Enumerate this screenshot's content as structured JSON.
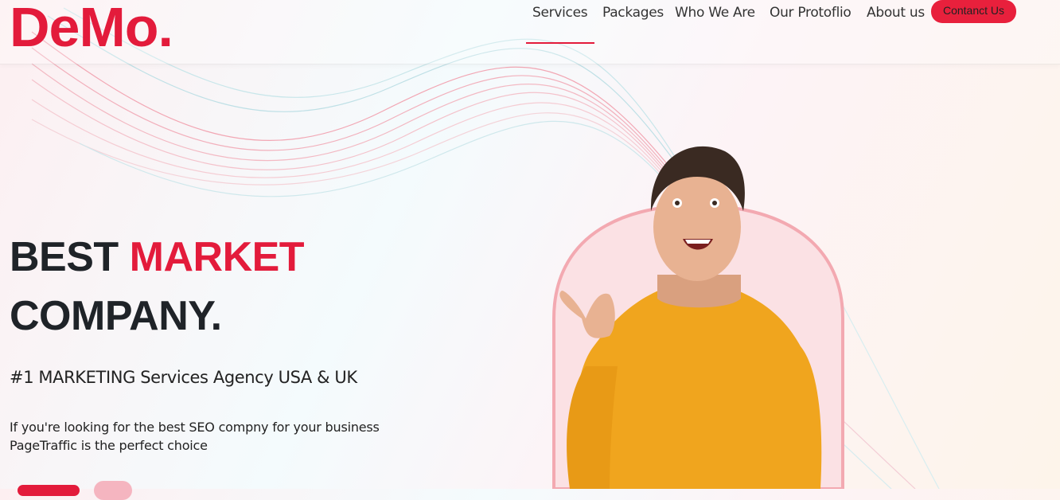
{
  "brand": {
    "logo_text": "DeMo."
  },
  "nav": {
    "items": [
      "Services",
      "Packages",
      "Who We Are",
      "Our Protoflio",
      "About us"
    ],
    "active": "Services",
    "contact_label": "Contanct Us"
  },
  "hero": {
    "title_part1": "BEST",
    "title_highlight": "MARKET",
    "title_line2": "COMPANY.",
    "subtitle": "#1 MARKETING Services Agency USA & UK",
    "description_line1": "If you're looking for the best SEO compny for your business",
    "description_line2": "PageTraffic is the perfect choice"
  },
  "colors": {
    "accent": "#e31b3b",
    "shirt": "#f0a51e"
  }
}
